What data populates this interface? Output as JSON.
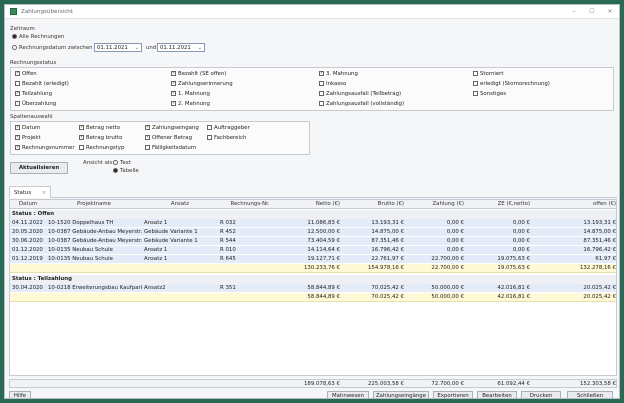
{
  "window": {
    "title": "Zahlungsübersicht",
    "minimize": "–",
    "close": "✕"
  },
  "zeitraum": {
    "label": "Zeitraum",
    "opt_all": "Alle Rechnungen",
    "opt_range": "Rechnungsdatum zwischen",
    "from": "01.11.2021",
    "and": "und",
    "to": "01.11.2021"
  },
  "rechnungsstatus": {
    "label": "Rechnungsstatus",
    "col1": [
      {
        "label": "Offen",
        "checked": true
      },
      {
        "label": "Bezahlt (erledigt)",
        "checked": false
      },
      {
        "label": "Teilzahlung",
        "checked": true
      },
      {
        "label": "Überzahlung",
        "checked": false
      }
    ],
    "col2": [
      {
        "label": "Bezahlt (SE offen)",
        "checked": true
      },
      {
        "label": "Zahlungserinnerung",
        "checked": true
      },
      {
        "label": "1. Mahnung",
        "checked": true
      },
      {
        "label": "2. Mahnung",
        "checked": true
      }
    ],
    "col3": [
      {
        "label": "3. Mahnung",
        "checked": true
      },
      {
        "label": "Inkasso",
        "checked": false
      },
      {
        "label": "Zahlungsausfall (Teilbetrag)",
        "checked": false
      },
      {
        "label": "Zahlungsausfall (vollständig)",
        "checked": false
      }
    ],
    "col4": [
      {
        "label": "Storniert",
        "checked": false
      },
      {
        "label": "erledigt (Stornorechnung)",
        "checked": false
      },
      {
        "label": "Sonstiges",
        "checked": false
      }
    ]
  },
  "spaltenauswahl": {
    "label": "Spaltenauswahl",
    "col1": [
      {
        "label": "Datum",
        "checked": true
      },
      {
        "label": "Projekt",
        "checked": true
      },
      {
        "label": "Rechnungsnummer",
        "checked": true
      }
    ],
    "col2": [
      {
        "label": "Betrag netto",
        "checked": true
      },
      {
        "label": "Betrag brutto",
        "checked": true
      },
      {
        "label": "Rechnungstyp",
        "checked": false
      }
    ],
    "col3": [
      {
        "label": "Zahlungseingang",
        "checked": true
      },
      {
        "label": "Offener Betrag",
        "checked": true
      },
      {
        "label": "Fälligkeitsdatum",
        "checked": false
      }
    ],
    "col4": [
      {
        "label": "Auftraggeber",
        "checked": false
      },
      {
        "label": "Fachbereich",
        "checked": false
      }
    ]
  },
  "actions": {
    "refresh": "Aktualisieren",
    "view_as": "Ansicht als:",
    "text": "Text",
    "table": "Tabelle"
  },
  "tab": {
    "label": "Status",
    "close": "×"
  },
  "columns": [
    "Datum",
    "Projektname",
    "Ansatz",
    "Rechnungs-Nr.",
    "Netto (€)",
    "Brutto (€)",
    "Zahlung (€)",
    "ZE (€,netto)",
    "offen (€)"
  ],
  "groups": [
    {
      "title": "Status : Offen",
      "rows": [
        [
          "04.11.2022",
          "10-1520 Doppelhaus TH",
          "Ansatz 1",
          "R 032",
          "11.086,83 €",
          "13.193,31 €",
          "0,00 €",
          "0,00 €",
          "13.193,31 €"
        ],
        [
          "20.05.2020",
          "10-0387 Gebäude-Anbau Meyerstr.",
          "Gebäude Variante 1",
          "R 452",
          "12.500,00 €",
          "14.875,00 €",
          "0,00 €",
          "0,00 €",
          "14.875,00 €"
        ],
        [
          "30.06.2020",
          "10-0387 Gebäude-Anbau Meyerstr.",
          "Gebäude Variante 1",
          "R 544",
          "73.404,59 €",
          "87.351,46 €",
          "0,00 €",
          "0,00 €",
          "87.351,46 €"
        ],
        [
          "01.12.2020",
          "10-0135 Neubau Schule",
          "Ansatz 1",
          "R 010",
          "14.114,64 €",
          "16.796,42 €",
          "0,00 €",
          "0,00 €",
          "16.796,42 €"
        ],
        [
          "01.12.2019",
          "10-0135 Neubau Schule",
          "Ansatz 1",
          "R 645",
          "19.127,71 €",
          "22.761,97 €",
          "22.700,00 €",
          "19.075,63 €",
          "61,97 €"
        ]
      ],
      "sum": [
        "130.233,76 €",
        "154.978,16 €",
        "22.700,00 €",
        "19.075,63 €",
        "132.278,16 €"
      ]
    },
    {
      "title": "Status : Teilzahlung",
      "rows": [
        [
          "30.04.2020",
          "10-0218 Erweiterungsbau Kaufpark GG",
          "Ansatz2",
          "R 351",
          "58.844,89 €",
          "70.025,42 €",
          "50.000,00 €",
          "42.016,81 €",
          "20.025,42 €"
        ]
      ],
      "sum": [
        "58.844,89 €",
        "70.025,42 €",
        "50.000,00 €",
        "42.016,81 €",
        "20.025,42 €"
      ]
    }
  ],
  "total": [
    "189.078,63 €",
    "225.003,58 €",
    "72.700,00 €",
    "61.092,44 €",
    "152.303,58 €"
  ],
  "buttons": {
    "help": "Hilfe",
    "reminders": "Mahnwesen",
    "payments": "Zahlungseingänge",
    "export": "Exportieren",
    "edit": "Bearbeiten",
    "print": "Drucken",
    "close": "Schließen"
  }
}
